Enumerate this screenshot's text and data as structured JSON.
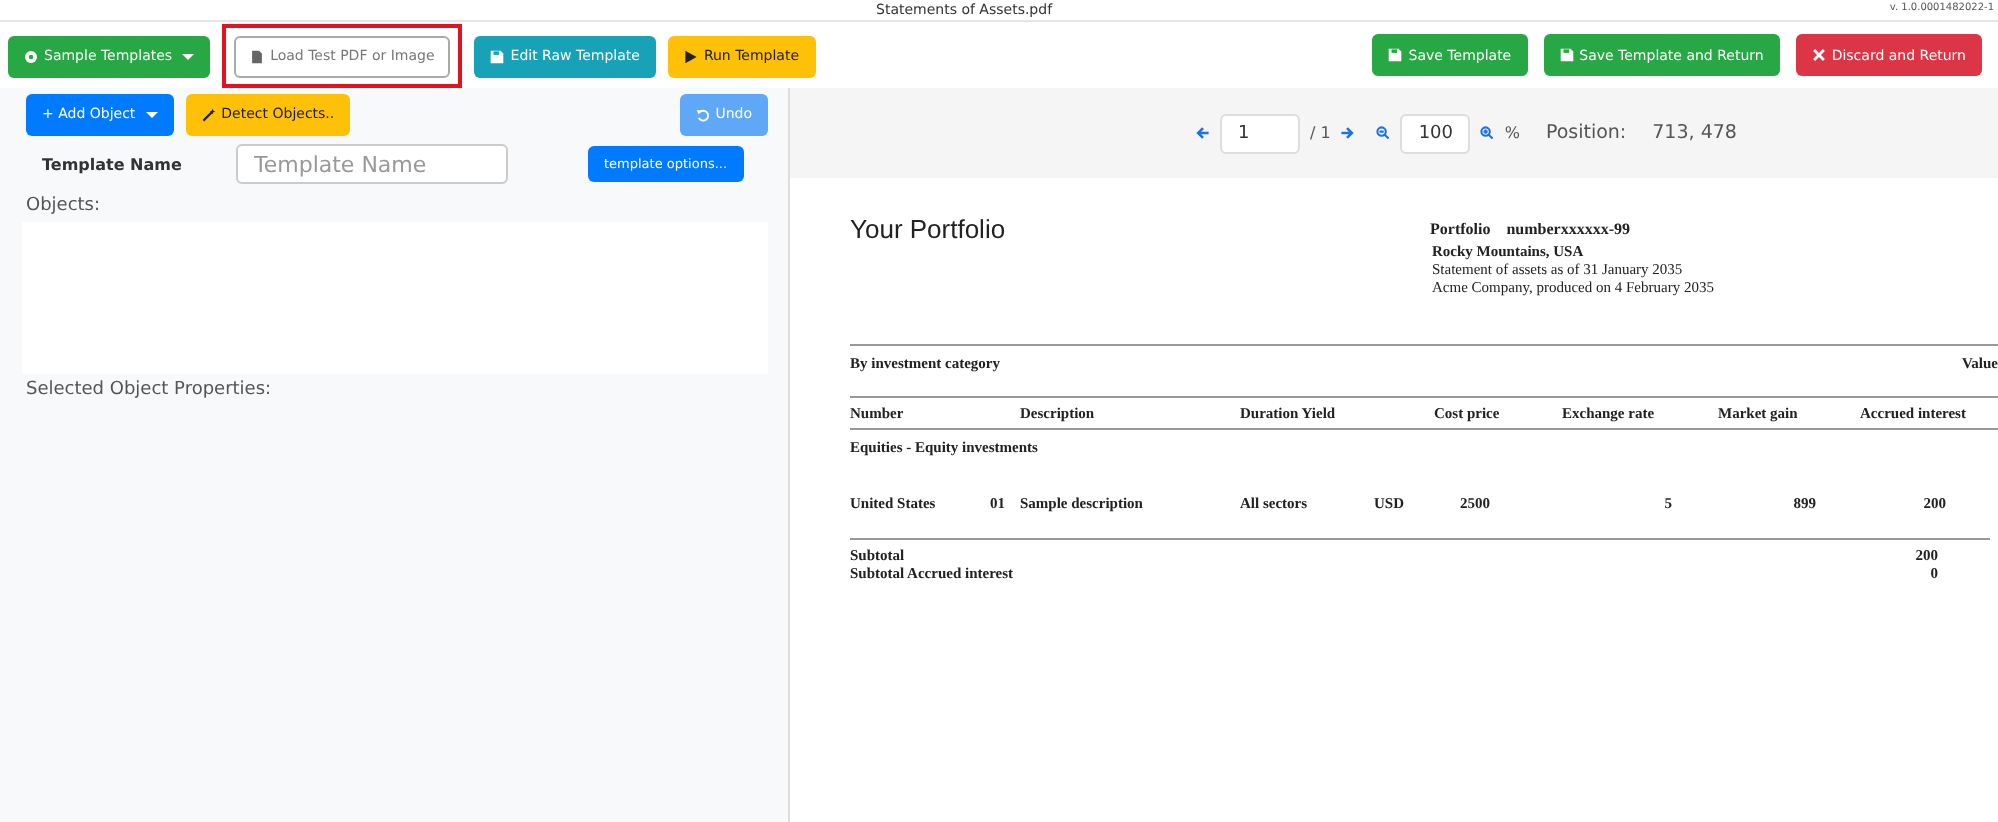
{
  "title_bar": {
    "filename": "Statements of Assets.pdf",
    "version": "v. 1.0.0001482022-1"
  },
  "toolbar": {
    "left_buttons": [
      {
        "kind": "samples",
        "label": "Sample Templates",
        "dropdown": true,
        "highlighted": false
      },
      {
        "kind": "load",
        "label": "Load Test PDF or Image",
        "dropdown": false,
        "highlighted": true
      },
      {
        "kind": "edit",
        "label": "Edit Raw Template",
        "dropdown": false,
        "highlighted": false
      },
      {
        "kind": "run",
        "label": "Run Template",
        "dropdown": false,
        "highlighted": false
      }
    ],
    "right_buttons": [
      {
        "kind": "save",
        "label": "Save Template"
      },
      {
        "kind": "save",
        "label": "Save Template and Return"
      },
      {
        "kind": "discard",
        "label": "Discard and Return"
      }
    ]
  },
  "editor": {
    "add_object": "+ Add Object",
    "detect_objects": "Detect Objects..",
    "undo": {
      "label": "Undo",
      "disabled": true
    },
    "template_name_label": "Template Name",
    "template_name_placeholder": "Template Name",
    "template_options": "template options...",
    "objects_heading": "Objects:",
    "properties_heading": "Selected Object Properties:"
  },
  "pager": {
    "page": "1",
    "total": "/ 1",
    "zoom": "100",
    "percent": "%",
    "position_label": "Position:",
    "position": "713, 478"
  },
  "document": {
    "title": "Your Portfolio",
    "portfolio_label": "Portfolio",
    "portfolio_number": "numberxxxxxx-99",
    "location": "Rocky Mountains, USA",
    "statement_date": "Statement of assets as of 31 January 2035",
    "produced": "Acme Company, produced on 4 February 2035",
    "section": "By investment category",
    "section_value": "Value",
    "columns": [
      "Number",
      "Description",
      "Duration Yield",
      "Cost price",
      "Exchange rate",
      "Market gain",
      "Accrued interest"
    ],
    "group": "Equities - Equity investments",
    "row": [
      "United States",
      "01",
      "Sample description",
      "All sectors",
      "USD",
      "2500",
      "5",
      "899",
      "200"
    ],
    "subtotals": [
      {
        "label": "Subtotal",
        "value": "200"
      },
      {
        "label": "Subtotal Accrued interest",
        "value": "0"
      }
    ]
  }
}
